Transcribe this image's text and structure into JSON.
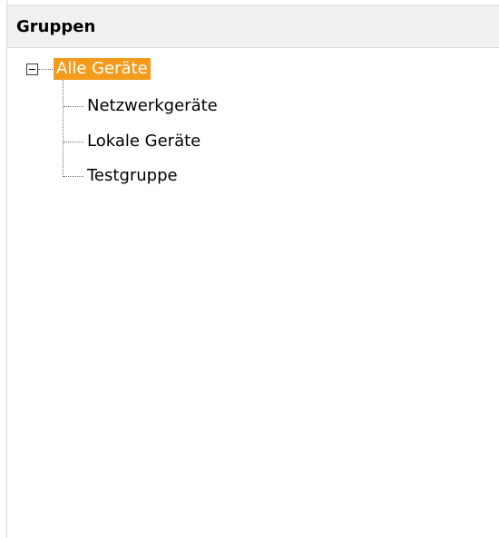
{
  "header": {
    "title": "Gruppen"
  },
  "tree": {
    "root": {
      "label": "Alle Geräte",
      "expanded": true,
      "selected": true
    },
    "children": [
      {
        "label": "Netzwerkgeräte"
      },
      {
        "label": "Lokale Geräte"
      },
      {
        "label": "Testgruppe"
      }
    ]
  },
  "colors": {
    "selection": "#f29b1c",
    "header_background": "#f0f0f0"
  }
}
